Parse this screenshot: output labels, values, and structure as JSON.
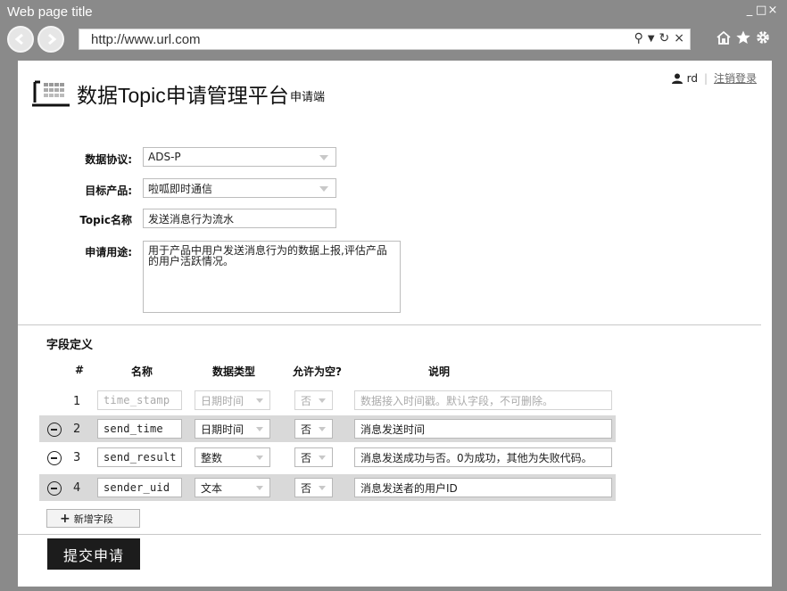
{
  "window": {
    "title": "Web page title",
    "controls": [
      "_",
      "□",
      "×"
    ]
  },
  "browser": {
    "url": "http://www.url.com",
    "url_icons": [
      "search-icon",
      "dropdown-icon",
      "refresh-icon",
      "close-icon"
    ],
    "toolbar_icons": [
      "home-icon",
      "star-icon",
      "gear-icon"
    ]
  },
  "header": {
    "app_title": "数据Topic申请管理平台",
    "app_subtitle": "申请端",
    "user_name": "rd",
    "separator": "|",
    "logout": "注销登录"
  },
  "form": {
    "protocol_label": "数据协议:",
    "protocol_value": "ADS-P",
    "product_label": "目标产品:",
    "product_value": "啦呱即时通信",
    "topic_label": "Topic名称",
    "topic_value": "发送消息行为流水",
    "purpose_label": "申请用途:",
    "purpose_value": "用于产品中用户发送消息行为的数据上报,评估产品\n的用户活跃情况。"
  },
  "fields": {
    "section_title": "字段定义",
    "columns": [
      "#",
      "名称",
      "数据类型",
      "允许为空?",
      "说明"
    ],
    "rows": [
      {
        "num": "1",
        "name": "time_stamp",
        "type": "日期时间",
        "nullable": "否",
        "desc": "数据接入时间戳。默认字段，不可删除。",
        "removable": false,
        "disabled": true,
        "shaded": false
      },
      {
        "num": "2",
        "name": "send_time",
        "type": "日期时间",
        "nullable": "否",
        "desc": "消息发送时间",
        "removable": true,
        "disabled": false,
        "shaded": true
      },
      {
        "num": "3",
        "name": "send_result",
        "type": "整数",
        "nullable": "否",
        "desc": "消息发送成功与否。0为成功，其他为失败代码。",
        "removable": true,
        "disabled": false,
        "shaded": false
      },
      {
        "num": "4",
        "name": "sender_uid",
        "type": "文本",
        "nullable": "否",
        "desc": "消息发送者的用户ID",
        "removable": true,
        "disabled": false,
        "shaded": true
      }
    ],
    "add_label": "新增字段"
  },
  "submit_label": "提交申请"
}
